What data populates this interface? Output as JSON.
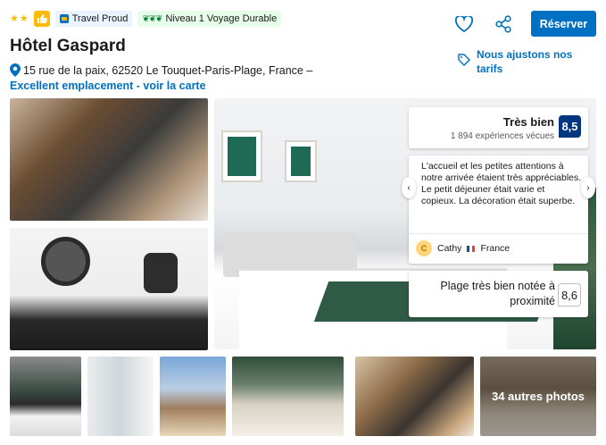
{
  "header": {
    "star_rating": 2,
    "travel_proud_label": "Travel Proud",
    "sustainability_label": "Niveau 1 Voyage Durable",
    "hotel_name": "Hôtel Gaspard",
    "address": "15 rue de la paix, 62520 Le Touquet-Paris-Plage, France –",
    "location_link": "Excellent emplacement - voir la carte"
  },
  "actions": {
    "reserve_label": "Réserver",
    "price_match_label": "Nous ajustons nos tarifs"
  },
  "gallery": {
    "more_photos_label": "34 autres photos"
  },
  "rating": {
    "word": "Très bien",
    "reviews_count": "1 894 expériences vécues",
    "score": "8,5"
  },
  "review": {
    "text": "L'accueil et les petites attentions à notre arrivée étaient très appréciables. Le petit déjeuner était varie et copieux. La décoration était superbe.",
    "reviewer_initial": "C",
    "reviewer_name": "Cathy",
    "reviewer_country": "France"
  },
  "location_rating": {
    "label": "Plage très bien notée à proximité",
    "score": "8,6"
  },
  "colors": {
    "brand_blue": "#0071c2",
    "score_navy": "#003580",
    "star_yellow": "#febb02",
    "sustainable_green": "#008234"
  }
}
